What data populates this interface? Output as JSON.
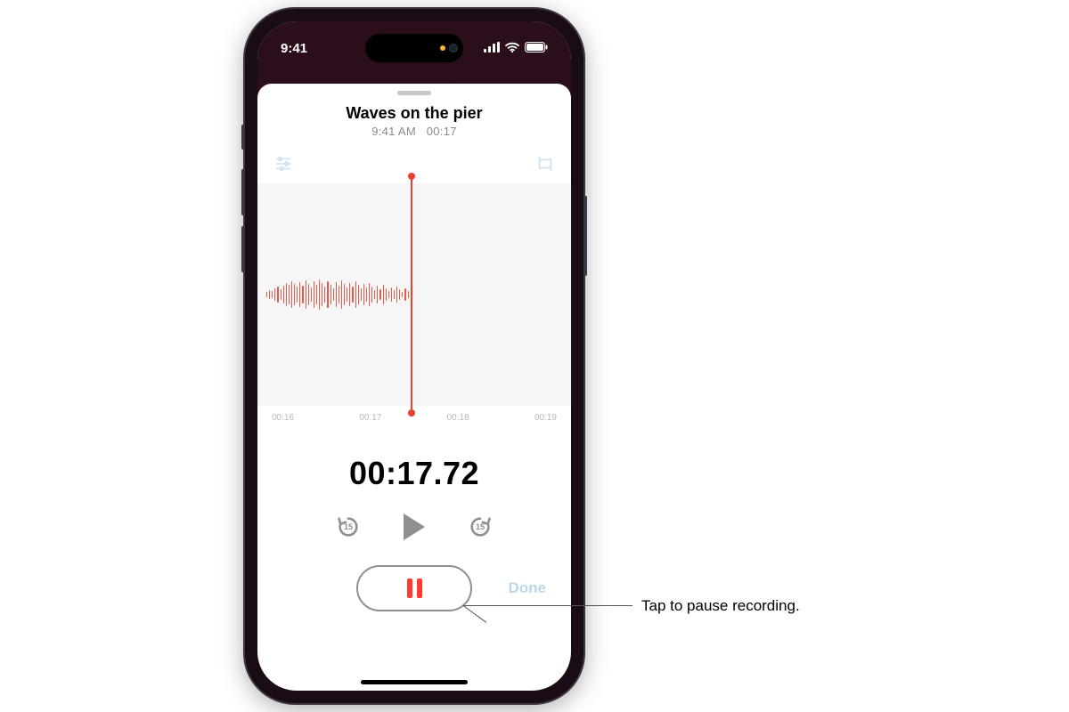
{
  "status": {
    "time": "9:41"
  },
  "recording": {
    "title": "Waves on the pier",
    "subtitle_time": "9:41 AM",
    "subtitle_duration": "00:17",
    "ruler": [
      "00:16",
      "00:17",
      "00:18",
      "00:19"
    ],
    "timer": "00:17.72",
    "skip_seconds": "15",
    "done_label": "Done"
  },
  "callout": {
    "text": "Tap to pause recording."
  },
  "colors": {
    "red": "#ff3b30",
    "wave": "#e75a4a",
    "muted": "#8e8e93",
    "lightblue": "#bcd7e6"
  }
}
